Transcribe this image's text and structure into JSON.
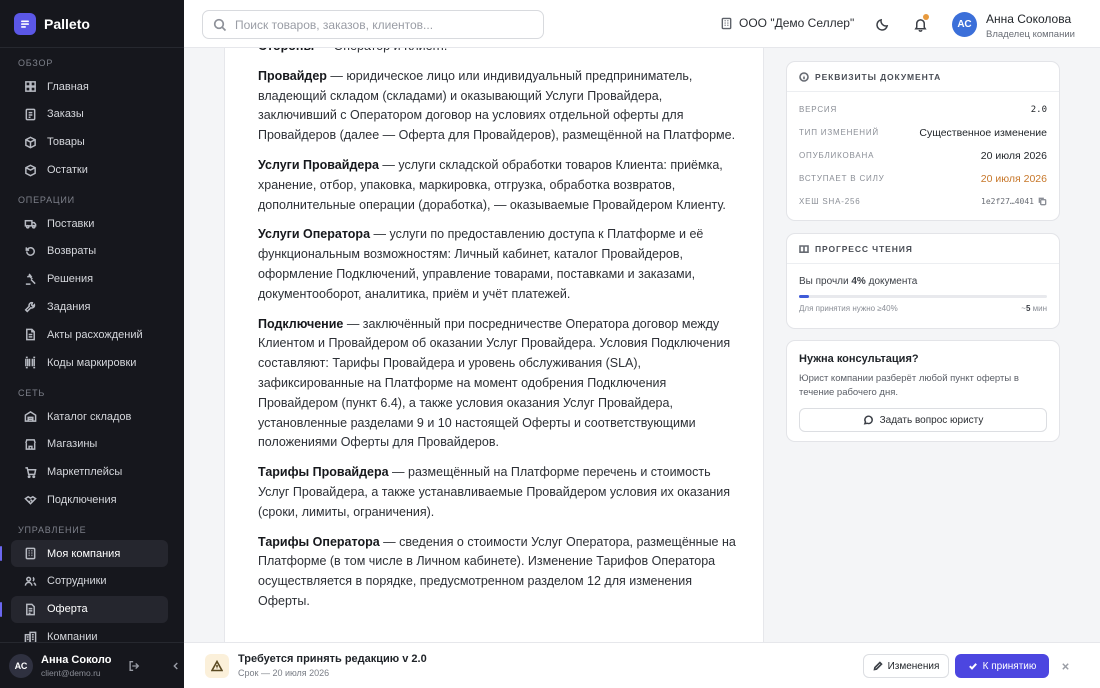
{
  "app": {
    "name": "Palleto"
  },
  "header": {
    "search_placeholder": "Поиск товаров, заказов, клиентов...",
    "organization": "ООО \"Демо Селлер\"",
    "user_initials": "АС",
    "user_name": "Анна Соколова",
    "user_role": "Владелец компании"
  },
  "sidebar": {
    "sections": [
      {
        "title": "Обзор",
        "items": [
          {
            "label": "Главная",
            "icon": "home-icon"
          },
          {
            "label": "Заказы",
            "icon": "orders-icon"
          },
          {
            "label": "Товары",
            "icon": "box-icon"
          },
          {
            "label": "Остатки",
            "icon": "stock-icon"
          }
        ]
      },
      {
        "title": "Операции",
        "items": [
          {
            "label": "Поставки",
            "icon": "truck-icon"
          },
          {
            "label": "Возвраты",
            "icon": "return-icon"
          },
          {
            "label": "Решения",
            "icon": "gavel-icon"
          },
          {
            "label": "Задания",
            "icon": "wrench-icon"
          },
          {
            "label": "Акты расхождений",
            "icon": "document-icon"
          },
          {
            "label": "Коды маркировки",
            "icon": "barcode-icon"
          }
        ]
      },
      {
        "title": "Сеть",
        "items": [
          {
            "label": "Каталог складов",
            "icon": "warehouse-icon"
          },
          {
            "label": "Магазины",
            "icon": "store-icon"
          },
          {
            "label": "Маркетплейсы",
            "icon": "cart-icon"
          },
          {
            "label": "Подключения",
            "icon": "handshake-icon"
          }
        ]
      },
      {
        "title": "Управление",
        "items": [
          {
            "label": "Моя компания",
            "icon": "building-icon",
            "active": true
          },
          {
            "label": "Сотрудники",
            "icon": "users-icon"
          },
          {
            "label": "Оферта",
            "icon": "contract-icon",
            "active": true
          },
          {
            "label": "Компании",
            "icon": "companies-icon"
          }
        ]
      }
    ],
    "footer": {
      "initials": "АС",
      "name": "Анна Соколова",
      "email": "client@demo.ru"
    }
  },
  "document": {
    "terms": [
      {
        "term": "",
        "text": "Стороны — Оператор и Клиент."
      },
      {
        "term": "Провайдер",
        "text": " — юридическое лицо или индивидуальный предприниматель, владеющий складом (складами) и оказывающий Услуги Провайдера, заключивший с Оператором договор на условиях отдельной оферты для Провайдеров (далее — Оферта для Провайдеров), размещённой на Платформе."
      },
      {
        "term": "Услуги Провайдера",
        "text": " — услуги складской обработки товаров Клиента: приёмка, хранение, отбор, упаковка, маркировка, отгрузка, обработка возвратов, дополнительные операции (доработка), — оказываемые Провайдером Клиенту."
      },
      {
        "term": "Услуги Оператора",
        "text": " — услуги по предоставлению доступа к Платформе и её функциональным возможностям: Личный кабинет, каталог Провайдеров, оформление Подключений, управление товарами, поставками и заказами, документооборот, аналитика, приём и учёт платежей."
      },
      {
        "term": "Подключение",
        "text": " — заключённый при посредничестве Оператора договор между Клиентом и Провайдером об оказании Услуг Провайдера. Условия Подключения составляют: Тарифы Провайдера и уровень обслуживания (SLA), зафиксированные на Платформе на момент одобрения Подключения Провайдером (пункт 6.4), а также условия оказания Услуг Провайдера, установленные разделами 9 и 10 настоящей Оферты и соответствующими положениями Оферты для Провайдеров."
      },
      {
        "term": "Тарифы Провайдера",
        "text": " — размещённый на Платформе перечень и стоимость Услуг Провайдера, а также устанавливаемые Провайдером условия их оказания (сроки, лимиты, ограничения)."
      },
      {
        "term": "Тарифы Оператора",
        "text": " — сведения о стоимости Услуг Оператора, размещённые на Платформе (в том числе в Личном кабинете). Изменение Тарифов Оператора осуществляется в порядке, предусмотренном разделом 12 для изменения Оферты."
      }
    ]
  },
  "details": {
    "title": "Реквизиты документа",
    "rows": [
      {
        "key": "Версия",
        "value": "2.0"
      },
      {
        "key": "Тип изменений",
        "value": "Существенное изменение"
      },
      {
        "key": "Опубликована",
        "value": "20 июля 2026"
      },
      {
        "key": "Вступает в силу",
        "value": "20 июля 2026"
      },
      {
        "key": "Хеш SHA-256",
        "value": "1e2f27…4041"
      }
    ],
    "accent_color": "#c7772a"
  },
  "progress": {
    "title": "Прогресс чтения",
    "text_before": "Вы прочли ",
    "percent_label": "4%",
    "text_after": " документа",
    "percent": 4,
    "required": "Для принятия нужно ≥40%",
    "time_prefix": "~",
    "time_value": "5",
    "time_unit": " мин",
    "bar_color": "#3f5bd8"
  },
  "consult": {
    "title": "Нужна консультация?",
    "text": "Юрист компании разберёт любой пункт оферты в течение рабочего дня.",
    "button": "Задать вопрос юристу"
  },
  "bottom_bar": {
    "title": "Требуется принять редакцию v 2.0",
    "subtitle": "Срок — 20 июля 2026",
    "changes_button": "Изменения",
    "accept_button": "К принятию",
    "accent_color": "#4c46e0"
  }
}
